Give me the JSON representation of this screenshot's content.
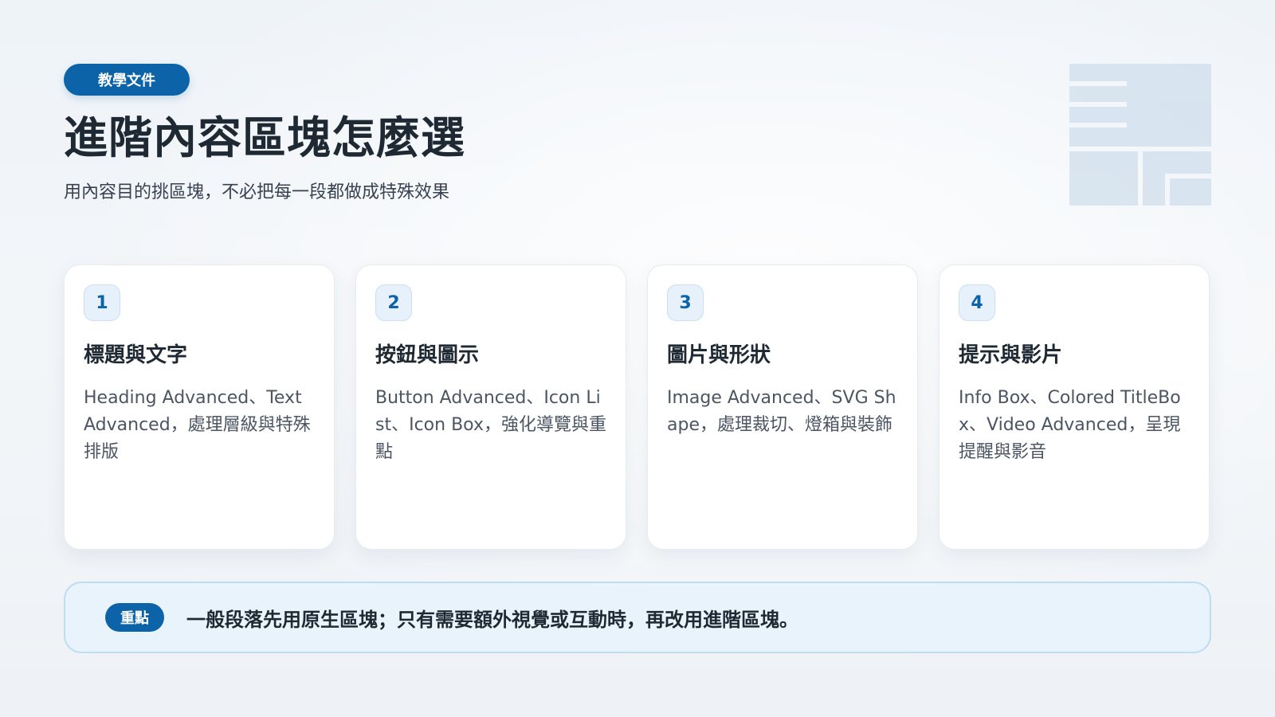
{
  "header": {
    "tag": "教學文件",
    "title": "進階內容區塊怎麼選",
    "subtitle": "用內容目的挑區塊，不必把每一段都做成特殊效果"
  },
  "cards": [
    {
      "number": "1",
      "title": "標題與文字",
      "description": "Heading Advanced、Text Advanced，處理層級與特殊排版"
    },
    {
      "number": "2",
      "title": "按鈕與圖示",
      "description": "Button Advanced、Icon List、Icon Box，強化導覽與重點"
    },
    {
      "number": "3",
      "title": "圖片與形狀",
      "description": "Image Advanced、SVG Shape，處理裁切、燈箱與裝飾"
    },
    {
      "number": "4",
      "title": "提示與影片",
      "description": "Info Box、Colored TitleBox、Video Advanced，呈現提醒與影音"
    }
  ],
  "note": {
    "badge": "重點",
    "text": "一般段落先用原生區塊；只有需要額外視覺或互動時，再改用進階區塊。"
  },
  "colors": {
    "accent": "#0d63a8",
    "card_number_bg": "#e6f1fb",
    "note_bg": "#e8f3fc",
    "note_border": "#bfdcf0",
    "decoration": "#c6d8e8"
  },
  "icons": {
    "decoration": "layout-grid-icon"
  }
}
